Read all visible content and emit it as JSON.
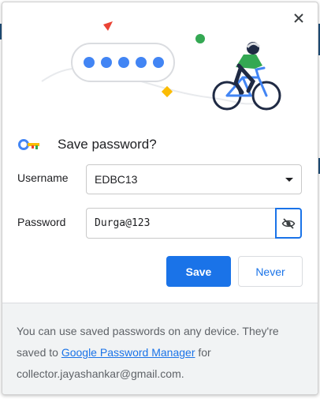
{
  "dialog": {
    "title": "Save password?",
    "username_label": "Username",
    "username_value": "EDBC13",
    "password_label": "Password",
    "password_value": "Durga@123",
    "save_label": "Save",
    "never_label": "Never"
  },
  "footer": {
    "text_before_link": "You can use saved passwords on any device. They're saved to ",
    "link_text": "Google Password Manager",
    "text_after_link": " for",
    "email": "collector.jayashankar@gmail.com."
  },
  "icons": {
    "close": "close-icon",
    "key": "key-icon",
    "eye": "eye-off-icon",
    "dropdown": "chevron-down-icon"
  },
  "colors": {
    "accent": "#1a73e8",
    "footer_bg": "#f1f3f4",
    "illustration_dots": "#4285f4",
    "triangle": "#ea4335",
    "circle": "#34a853",
    "diamond": "#fbbc04"
  }
}
